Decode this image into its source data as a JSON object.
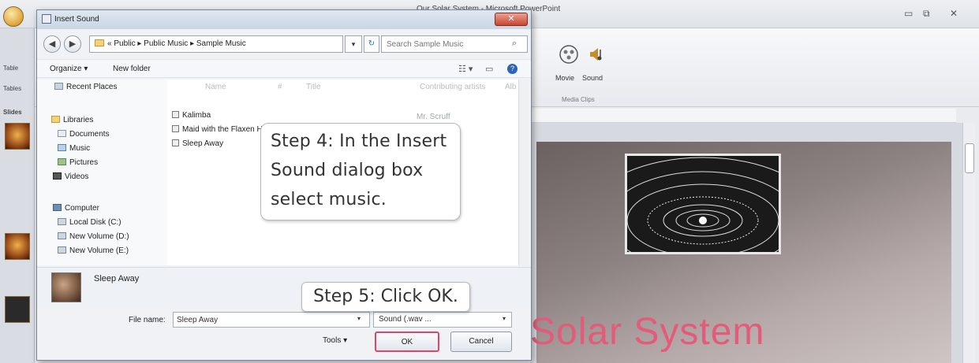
{
  "powerpoint": {
    "window_title": "Our Solar System - Microsoft PowerPoint",
    "ribbon": {
      "sound_buttons": [
        {
          "label": "Movie",
          "icon": "film-reel-icon"
        },
        {
          "label": "Sound",
          "icon": "speaker-note-icon"
        }
      ],
      "group_label": "Media Clips",
      "left_labels": [
        "Table",
        "Tables"
      ]
    },
    "slides_tab_label": "Slides",
    "slide": {
      "title": "Solar System",
      "title_color": "#e45a7a",
      "image": "solar-system-diagram"
    }
  },
  "dialog": {
    "title": "Insert Sound",
    "close_label": "✕",
    "breadcrumb": [
      "«",
      "Public",
      "Public Music",
      "Sample Music"
    ],
    "search_placeholder": "Search Sample Music",
    "toolbar": {
      "organize_label": "Organize ▾",
      "new_folder_label": "New folder"
    },
    "nav_items": [
      {
        "label": "Recent Places",
        "icon": "recent-places-icon"
      },
      {
        "label": "Libraries",
        "icon": "libraries-icon"
      },
      {
        "label": "Documents",
        "icon": "documents-icon"
      },
      {
        "label": "Music",
        "icon": "music-icon"
      },
      {
        "label": "Pictures",
        "icon": "pictures-icon"
      },
      {
        "label": "Videos",
        "icon": "videos-icon"
      },
      {
        "label": "Computer",
        "icon": "computer-icon"
      },
      {
        "label": "Local Disk (C:)",
        "icon": "disk-icon"
      },
      {
        "label": "New Volume (D:)",
        "icon": "disk-icon"
      },
      {
        "label": "New Volume (E:)",
        "icon": "disk-icon"
      }
    ],
    "columns": [
      "Name",
      "#",
      "Title",
      "Contributing artists",
      "Alb"
    ],
    "files": [
      {
        "name": "Kalimba",
        "artist": "Mr. Scruff"
      },
      {
        "name": "Maid with the Flaxen Hair",
        "artist": ""
      },
      {
        "name": "Sleep Away",
        "artist": ""
      }
    ],
    "details": {
      "name": "Sleep Away"
    },
    "file_name_label": "File name:",
    "file_name_value": "Sleep Away",
    "file_type_value": "Sound (.wav ...",
    "tools_label": "Tools ▾",
    "ok_label": "OK",
    "cancel_label": "Cancel"
  },
  "annotations": {
    "step4": "Step 4: In the Insert Sound dialog box select music.",
    "step5": "Step 5: Click OK.",
    "highlight_color": "#d8486c"
  }
}
